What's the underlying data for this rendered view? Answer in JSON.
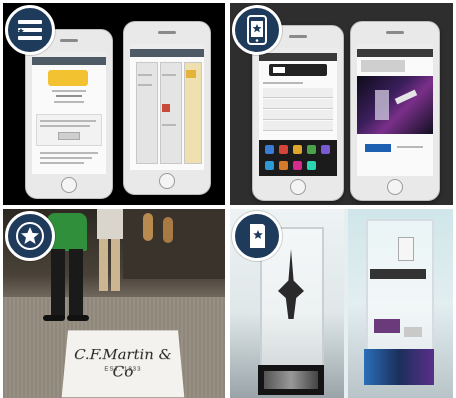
{
  "tiles": {
    "top_left": {
      "icon": "menu-list-icon",
      "background": "#000000"
    },
    "top_right": {
      "icon": "mobile-phone-star-icon",
      "background": "#2e2e2e"
    },
    "bottom_left": {
      "icon": "star-icon",
      "background": "#5a5248"
    },
    "bottom_right": {
      "icon": "booklet-star-icon",
      "background": "#e6eef0"
    }
  },
  "floor_logo": {
    "brand": "C.F.Martin & Co",
    "tagline": "EST. 1833"
  },
  "colors": {
    "badge": "#1f3b5c",
    "shirt_green": "#2f8f3a"
  }
}
